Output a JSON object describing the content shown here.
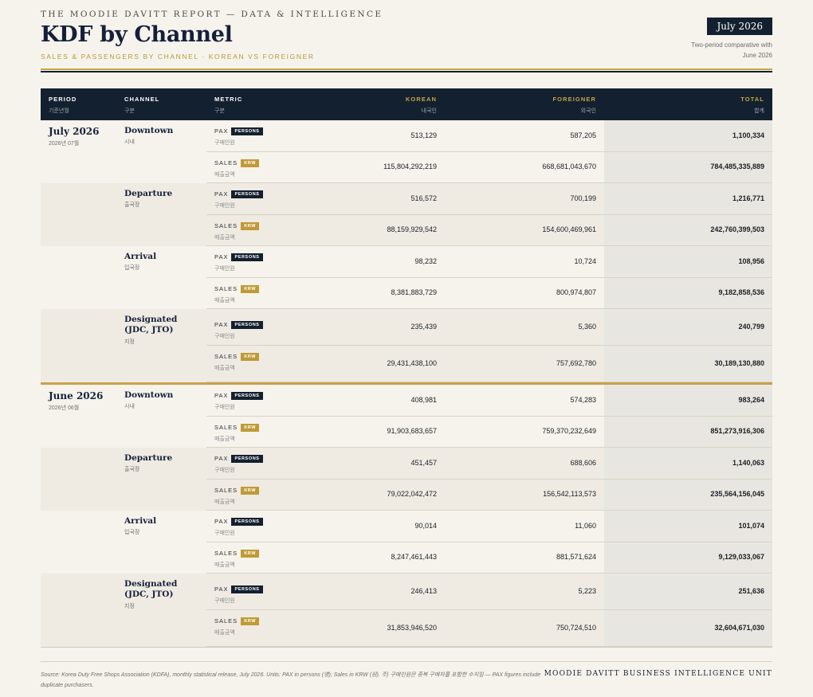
{
  "header": {
    "kicker": "THE MOODIE DAVITT REPORT — DATA & INTELLIGENCE",
    "title": "KDF by Channel",
    "subtitle": "SALES & PASSENGERS BY CHANNEL · KOREAN VS FOREIGNER",
    "period_badge": "July 2026",
    "compare_note": "Two-period comparative with June 2026"
  },
  "columns": {
    "period": {
      "en": "PERIOD",
      "ko": "기준년월"
    },
    "channel": {
      "en": "CHANNEL",
      "ko": "구분"
    },
    "metric": {
      "en": "METRIC",
      "ko": "구분"
    },
    "korean": {
      "en": "KOREAN",
      "ko": "내국인"
    },
    "foreigner": {
      "en": "FOREIGNER",
      "ko": "외국인"
    },
    "total": {
      "en": "TOTAL",
      "ko": "합계"
    }
  },
  "metric_labels": {
    "pax": {
      "en": "PAX",
      "badge": "PERSONS",
      "ko": "구매인원"
    },
    "sales": {
      "en": "SALES",
      "badge": "KRW",
      "ko": "매출금액"
    }
  },
  "periods": [
    {
      "label": "July 2026",
      "ko": "2026년 07월",
      "channels": [
        {
          "name": "Downtown",
          "ko": "시내",
          "pax": {
            "korean": "513,129",
            "foreigner": "587,205",
            "total": "1,100,334"
          },
          "sales": {
            "korean": "115,804,292,219",
            "foreigner": "668,681,043,670",
            "total": "784,485,335,889"
          }
        },
        {
          "name": "Departure",
          "ko": "출국장",
          "pax": {
            "korean": "516,572",
            "foreigner": "700,199",
            "total": "1,216,771"
          },
          "sales": {
            "korean": "88,159,929,542",
            "foreigner": "154,600,469,961",
            "total": "242,760,399,503"
          }
        },
        {
          "name": "Arrival",
          "ko": "입국장",
          "pax": {
            "korean": "98,232",
            "foreigner": "10,724",
            "total": "108,956"
          },
          "sales": {
            "korean": "8,381,883,729",
            "foreigner": "800,974,807",
            "total": "9,182,858,536"
          }
        },
        {
          "name": "Designated (JDC, JTO)",
          "ko": "지정",
          "pax": {
            "korean": "235,439",
            "foreigner": "5,360",
            "total": "240,799"
          },
          "sales": {
            "korean": "29,431,438,100",
            "foreigner": "757,692,780",
            "total": "30,189,130,880"
          }
        }
      ]
    },
    {
      "label": "June 2026",
      "ko": "2026년 06월",
      "channels": [
        {
          "name": "Downtown",
          "ko": "시내",
          "pax": {
            "korean": "408,981",
            "foreigner": "574,283",
            "total": "983,264"
          },
          "sales": {
            "korean": "91,903,683,657",
            "foreigner": "759,370,232,649",
            "total": "851,273,916,306"
          }
        },
        {
          "name": "Departure",
          "ko": "출국장",
          "pax": {
            "korean": "451,457",
            "foreigner": "688,606",
            "total": "1,140,063"
          },
          "sales": {
            "korean": "79,022,042,472",
            "foreigner": "156,542,113,573",
            "total": "235,564,156,045"
          }
        },
        {
          "name": "Arrival",
          "ko": "입국장",
          "pax": {
            "korean": "90,014",
            "foreigner": "11,060",
            "total": "101,074"
          },
          "sales": {
            "korean": "8,247,461,443",
            "foreigner": "881,571,624",
            "total": "9,129,033,067"
          }
        },
        {
          "name": "Designated (JDC, JTO)",
          "ko": "지정",
          "pax": {
            "korean": "246,413",
            "foreigner": "5,223",
            "total": "251,636"
          },
          "sales": {
            "korean": "31,853,946,520",
            "foreigner": "750,724,510",
            "total": "32,604,671,030"
          }
        }
      ]
    }
  ],
  "footer": {
    "source": "Source: Korea Duty Free Shops Association (KDFA), monthly statistical release, July 2026. Units: PAX in persons (명); Sales in KRW (원). 주) 구매인원은 중복 구매자를 포함한 수치임 — PAX figures include duplicate purchasers.",
    "unit": "MOODIE DAVITT BUSINESS INTELLIGENCE UNIT"
  },
  "colors": {
    "navy": "#13202f",
    "gold": "#c6a24b",
    "badge_krw": "#c09a37",
    "background": "#f6f3ec",
    "band_alt": "#efebe3",
    "total_column": "#e8e6e0"
  }
}
